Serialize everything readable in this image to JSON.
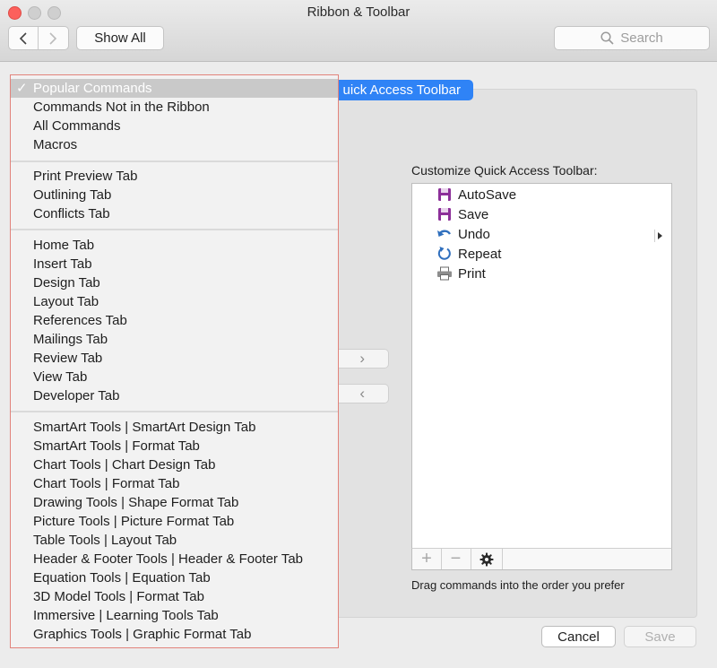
{
  "window": {
    "title": "Ribbon & Toolbar",
    "show_all_label": "Show All",
    "search_placeholder": "Search"
  },
  "tab_label": "uick Access Toolbar",
  "menu": {
    "checkmark": "✓",
    "items": [
      "Popular Commands",
      "Commands Not in the Ribbon",
      "All Commands",
      "Macros",
      "Print Preview Tab",
      "Outlining Tab",
      "Conflicts Tab",
      "Home Tab",
      "Insert Tab",
      "Design Tab",
      "Layout Tab",
      "References Tab",
      "Mailings Tab",
      "Review Tab",
      "View Tab",
      "Developer Tab",
      "SmartArt Tools | SmartArt Design Tab",
      "SmartArt Tools | Format Tab",
      "Chart Tools | Chart Design Tab",
      "Chart Tools | Format Tab",
      "Drawing Tools | Shape Format Tab",
      "Picture Tools | Picture Format Tab",
      "Table Tools | Layout Tab",
      "Header & Footer Tools | Header & Footer Tab",
      "Equation Tools | Equation Tab",
      "3D Model Tools | Format Tab",
      "Immersive | Learning Tools Tab",
      "Graphics Tools | Graphic Format Tab"
    ],
    "selected_index": 0
  },
  "qat": {
    "label": "Customize Quick Access Toolbar:",
    "items": [
      {
        "label": "AutoSave",
        "icon": "floppy-disk-icon"
      },
      {
        "label": "Save",
        "icon": "floppy-disk-icon"
      },
      {
        "label": "Undo",
        "icon": "undo-arrow-icon"
      },
      {
        "label": "Repeat",
        "icon": "repeat-arrow-icon"
      },
      {
        "label": "Print",
        "icon": "printer-icon"
      }
    ],
    "add_symbol": "+",
    "remove_symbol": "−",
    "hint": "Drag commands into the order you prefer"
  },
  "arrows": {
    "add": "›",
    "remove": "‹"
  },
  "footer": {
    "cancel_label": "Cancel",
    "save_label": "Save"
  },
  "colors": {
    "accent": "#2f83f6",
    "close_button": "#fc605c",
    "menu_border": "#e2837b",
    "save_icon": "#8c2f99",
    "undo_icon": "#2f6fbd"
  }
}
